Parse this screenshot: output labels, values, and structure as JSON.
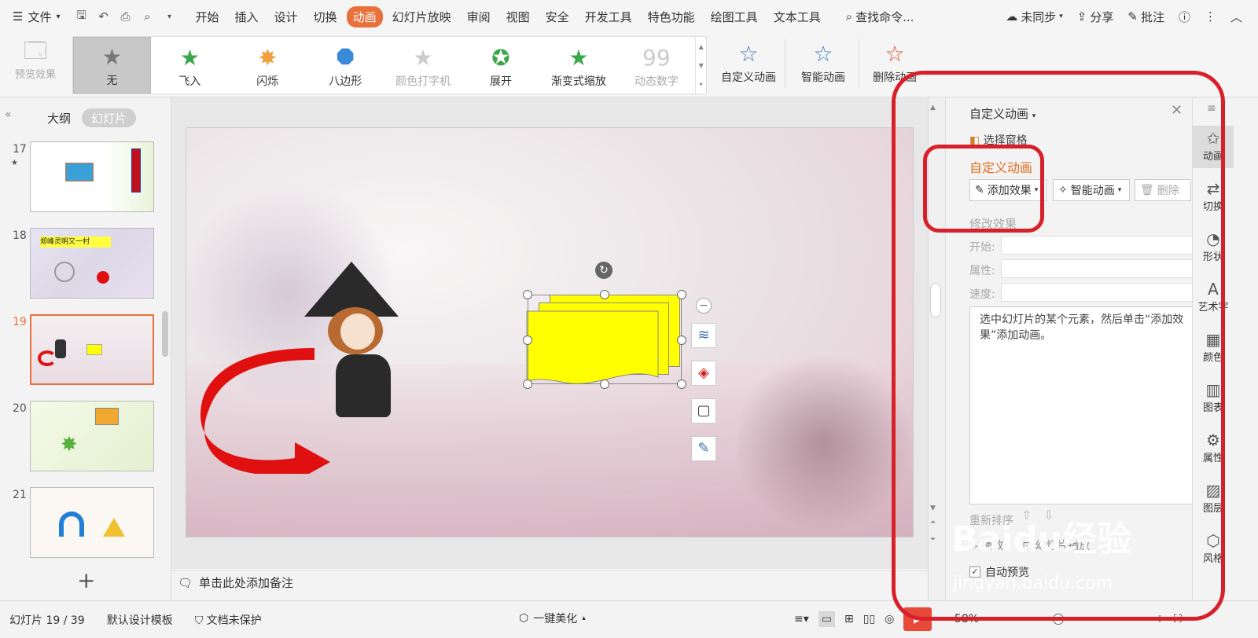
{
  "menubar": {
    "file_label": "文件",
    "tabs": [
      {
        "label": "开始"
      },
      {
        "label": "插入"
      },
      {
        "label": "设计"
      },
      {
        "label": "切换"
      },
      {
        "label": "动画"
      },
      {
        "label": "幻灯片放映"
      },
      {
        "label": "审阅"
      },
      {
        "label": "视图"
      },
      {
        "label": "安全"
      },
      {
        "label": "开发工具"
      },
      {
        "label": "特色功能"
      },
      {
        "label": "绘图工具"
      },
      {
        "label": "文本工具"
      }
    ],
    "search_label": "查找命令...",
    "sync_label": "未同步",
    "share_label": "分享",
    "comment_label": "批注"
  },
  "ribbon": {
    "preview_label": "预览效果",
    "gallery": [
      {
        "label": "无"
      },
      {
        "label": "飞入"
      },
      {
        "label": "闪烁"
      },
      {
        "label": "八边形"
      },
      {
        "label": "颜色打字机"
      },
      {
        "label": "展开"
      },
      {
        "label": "渐变式缩放"
      },
      {
        "label": "动态数字"
      }
    ],
    "custom_anim_label": "自定义动画",
    "smart_anim_label": "智能动画",
    "delete_anim_label": "删除动画"
  },
  "leftpanel": {
    "outline_tab": "大纲",
    "slides_tab": "幻灯片",
    "slides": [
      {
        "number": "17"
      },
      {
        "number": "18"
      },
      {
        "number": "19"
      },
      {
        "number": "20"
      },
      {
        "number": "21"
      }
    ],
    "slide18_title": "郑峰灵明又一村",
    "add_label": "+"
  },
  "notes": {
    "placeholder": "单击此处添加备注"
  },
  "taskpane": {
    "title": "自定义动画",
    "select_pane": "选择窗格",
    "section_title": "自定义动画",
    "add_effect": "添加效果",
    "smart_anim": "智能动画",
    "delete": "删除",
    "modify_title": "修改效果",
    "start_label": "开始:",
    "property_label": "属性:",
    "speed_label": "速度:",
    "hint": "选中幻灯片的某个元素，然后单击“添加效果”添加动画。",
    "reorder_label": "重新排序",
    "play_label": "播放",
    "slideshow_label": "幻灯片播放",
    "autopreview_label": "自动预览"
  },
  "sidebar": {
    "items": [
      {
        "label": "动画",
        "icon": "animation-icon"
      },
      {
        "label": "切换",
        "icon": "transition-icon"
      },
      {
        "label": "形状",
        "icon": "shape-icon"
      },
      {
        "label": "艺术字",
        "icon": "wordart-icon"
      },
      {
        "label": "颜色",
        "icon": "color-icon"
      },
      {
        "label": "图表",
        "icon": "chart-icon"
      },
      {
        "label": "属性",
        "icon": "property-icon"
      },
      {
        "label": "图层",
        "icon": "layer-icon"
      },
      {
        "label": "风格",
        "icon": "style-icon"
      }
    ]
  },
  "statusbar": {
    "slide_info": "幻灯片 19 / 39",
    "template": "默认设计模板",
    "protect": "文档未保护",
    "beautify": "一键美化",
    "zoom": "58%"
  },
  "watermark": {
    "text": "Baidu经验",
    "url": "jingyan.baidu.com"
  },
  "colors": {
    "accent": "#e8703a",
    "annotation": "#d8202a",
    "shape_fill": "#ffff00",
    "arrow": "#e01010"
  }
}
